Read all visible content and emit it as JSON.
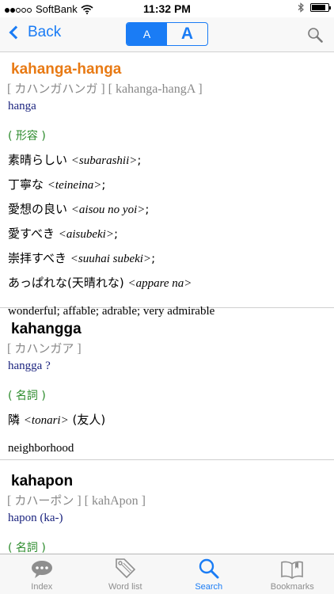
{
  "status": {
    "carrier": "SoftBank",
    "time": "11:32 PM"
  },
  "nav": {
    "back_label": "Back",
    "font_small": "A",
    "font_large": "A"
  },
  "entries": [
    {
      "headword": "kahanga-hanga",
      "kana": "カハンガハンガ",
      "romaji": "kahanga-hangA",
      "etymology": "hanga",
      "pos": "形容",
      "senses": [
        {
          "jp": "素晴らしい",
          "reading": "<subarashii>",
          "suffix": ";"
        },
        {
          "jp": "丁寧な",
          "reading": "<teineina>",
          "suffix": ";"
        },
        {
          "jp": "愛想の良い",
          "reading": "<aisou no yoi>",
          "suffix": ";"
        },
        {
          "jp": "愛すべき",
          "reading": "<aisubeki>",
          "suffix": ";"
        },
        {
          "jp": "崇拝すべき",
          "reading": "<suuhai subeki>",
          "suffix": ";"
        },
        {
          "jp": "あっぱれな(天晴れな)",
          "reading": "<appare na>",
          "suffix": ""
        }
      ],
      "english": "wonderful; affable; adrable; very admirable"
    },
    {
      "headword": "kahangga",
      "kana": "カハンガア",
      "etymology": "hangga ?",
      "pos": "名詞",
      "senses": [
        {
          "jp": "隣",
          "reading": "<tonari>",
          "suffix": " (友人)"
        }
      ],
      "english": "neighborhood"
    },
    {
      "headword": "kahapon",
      "kana": "カハーポン",
      "romaji": "kahApon",
      "etymology": "hapon (ka-)",
      "pos": "名詞"
    }
  ],
  "tabs": [
    {
      "label": "Index",
      "icon": "speech-bubble-icon"
    },
    {
      "label": "Word list",
      "icon": "tag-icon"
    },
    {
      "label": "Search",
      "icon": "magnifier-icon"
    },
    {
      "label": "Bookmarks",
      "icon": "book-icon"
    }
  ],
  "colors": {
    "accent": "#1a7cf5",
    "headword_highlight": "#e87a14",
    "pos": "#2a8a2a",
    "etymology": "#1a237e"
  }
}
